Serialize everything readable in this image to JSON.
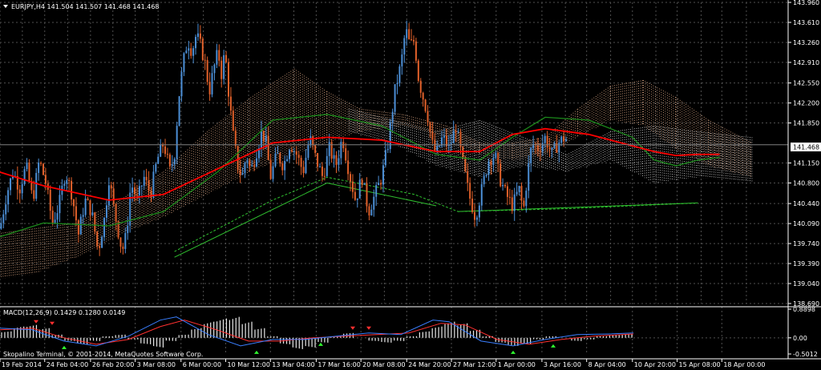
{
  "chart_data": [
    {
      "type": "candlestick",
      "symbol_header": "EURJPY,H4  141.504 141.507 141.468 141.468",
      "current_price": "141.468",
      "current_price_value": 141.468,
      "ylim": [
        138.69,
        143.96
      ],
      "y_ticks": [
        "143.960",
        "143.610",
        "143.260",
        "142.910",
        "142.550",
        "142.200",
        "141.850",
        "141.150",
        "140.800",
        "140.440",
        "140.090",
        "139.740",
        "139.390",
        "139.040",
        "138.690"
      ],
      "y_tick_values": [
        143.96,
        143.61,
        143.26,
        142.91,
        142.55,
        142.2,
        141.85,
        141.15,
        140.8,
        140.44,
        140.09,
        139.74,
        139.39,
        139.04,
        138.69
      ],
      "x_ticks": [
        "19 Feb 2014",
        "24 Feb 04:00",
        "26 Feb 20:00",
        "3 Mar 08:00",
        "6 Mar 00:00",
        "10 Mar 12:00",
        "13 Mar 04:00",
        "17 Mar 16:00",
        "20 Mar 08:00",
        "24 Mar 20:00",
        "27 Mar 12:00",
        "1 Apr 00:00",
        "3 Apr 16:00",
        "8 Apr 04:00",
        "10 Apr 20:00",
        "15 Apr 08:00",
        "18 Apr 00:00"
      ],
      "x_tick_pos": [
        0,
        41,
        83,
        124,
        166,
        207,
        248,
        290,
        331,
        373,
        414,
        455,
        497,
        538,
        580,
        621,
        662
      ],
      "close_path": [
        [
          0,
          140.0
        ],
        [
          6,
          140.6
        ],
        [
          12,
          141.0
        ],
        [
          18,
          140.7
        ],
        [
          24,
          141.1
        ],
        [
          30,
          140.5
        ],
        [
          36,
          141.2
        ],
        [
          42,
          140.8
        ],
        [
          48,
          140.1
        ],
        [
          54,
          140.4
        ],
        [
          60,
          141.0
        ],
        [
          66,
          140.6
        ],
        [
          72,
          139.9
        ],
        [
          78,
          140.5
        ],
        [
          84,
          140.3
        ],
        [
          90,
          139.6
        ],
        [
          96,
          140.2
        ],
        [
          100,
          140.9
        ],
        [
          104,
          140.4
        ],
        [
          108,
          140.0
        ],
        [
          112,
          139.6
        ],
        [
          116,
          139.9
        ],
        [
          120,
          140.8
        ],
        [
          126,
          140.5
        ],
        [
          132,
          140.9
        ],
        [
          138,
          140.6
        ],
        [
          144,
          141.2
        ],
        [
          150,
          141.5
        ],
        [
          156,
          141.0
        ],
        [
          160,
          141.3
        ],
        [
          164,
          142.3
        ],
        [
          168,
          142.9
        ],
        [
          172,
          143.3
        ],
        [
          176,
          143.1
        ],
        [
          180,
          143.4
        ],
        [
          184,
          143.2
        ],
        [
          188,
          142.9
        ],
        [
          192,
          142.4
        ],
        [
          196,
          142.8
        ],
        [
          200,
          143.1
        ],
        [
          204,
          142.6
        ],
        [
          206,
          143.2
        ],
        [
          210,
          142.3
        ],
        [
          214,
          141.6
        ],
        [
          218,
          141.1
        ],
        [
          222,
          140.9
        ],
        [
          226,
          141.3
        ],
        [
          230,
          141.0
        ],
        [
          236,
          141.4
        ],
        [
          240,
          141.7
        ],
        [
          244,
          141.5
        ],
        [
          248,
          140.9
        ],
        [
          254,
          141.3
        ],
        [
          260,
          141.1
        ],
        [
          266,
          141.5
        ],
        [
          272,
          141.3
        ],
        [
          278,
          141.0
        ],
        [
          284,
          141.6
        ],
        [
          290,
          141.2
        ],
        [
          296,
          140.9
        ],
        [
          302,
          141.4
        ],
        [
          308,
          141.1
        ],
        [
          314,
          141.6
        ],
        [
          320,
          141.0
        ],
        [
          326,
          140.5
        ],
        [
          332,
          140.9
        ],
        [
          338,
          140.3
        ],
        [
          344,
          140.6
        ],
        [
          350,
          140.9
        ],
        [
          356,
          141.5
        ],
        [
          362,
          142.4
        ],
        [
          368,
          142.9
        ],
        [
          372,
          143.5
        ],
        [
          376,
          143.2
        ],
        [
          380,
          143.3
        ],
        [
          384,
          142.6
        ],
        [
          388,
          142.3
        ],
        [
          392,
          142.0
        ],
        [
          396,
          141.5
        ],
        [
          400,
          141.3
        ],
        [
          406,
          141.6
        ],
        [
          412,
          141.4
        ],
        [
          418,
          141.8
        ],
        [
          424,
          141.2
        ],
        [
          430,
          140.6
        ],
        [
          436,
          140.2
        ],
        [
          442,
          140.7
        ],
        [
          448,
          141.2
        ],
        [
          454,
          141.3
        ],
        [
          458,
          140.9
        ],
        [
          464,
          140.6
        ],
        [
          470,
          140.4
        ],
        [
          476,
          140.7
        ],
        [
          480,
          140.3
        ],
        [
          484,
          141.0
        ],
        [
          488,
          141.5
        ],
        [
          494,
          141.4
        ],
        [
          500,
          141.6
        ],
        [
          506,
          141.3
        ],
        [
          512,
          141.5
        ],
        [
          518,
          141.6
        ],
        [
          521,
          141.5
        ]
      ],
      "sma_red": [
        [
          -10,
          141.05
        ],
        [
          40,
          140.75
        ],
        [
          100,
          140.5
        ],
        [
          150,
          140.6
        ],
        [
          200,
          141.05
        ],
        [
          250,
          141.5
        ],
        [
          300,
          141.6
        ],
        [
          350,
          141.55
        ],
        [
          400,
          141.35
        ],
        [
          440,
          141.35
        ],
        [
          470,
          141.65
        ],
        [
          500,
          141.75
        ],
        [
          540,
          141.65
        ],
        [
          580,
          141.45
        ],
        [
          600,
          141.35
        ],
        [
          620,
          141.28
        ],
        [
          640,
          141.3
        ],
        [
          660,
          141.3
        ]
      ],
      "sma_green": [
        [
          -10,
          139.8
        ],
        [
          40,
          140.1
        ],
        [
          100,
          140.05
        ],
        [
          150,
          140.3
        ],
        [
          200,
          141.0
        ],
        [
          250,
          141.9
        ],
        [
          300,
          142.0
        ],
        [
          350,
          141.8
        ],
        [
          400,
          141.3
        ],
        [
          440,
          141.2
        ],
        [
          470,
          141.6
        ],
        [
          500,
          141.95
        ],
        [
          540,
          141.9
        ],
        [
          580,
          141.6
        ],
        [
          600,
          141.2
        ],
        [
          620,
          141.1
        ],
        [
          640,
          141.2
        ],
        [
          660,
          141.25
        ]
      ],
      "cloud_orange": [
        [
          -10,
          139.9,
          139.1
        ],
        [
          30,
          140.0,
          139.2
        ],
        [
          70,
          140.1,
          139.5
        ],
        [
          110,
          140.5,
          139.9
        ],
        [
          150,
          141.0,
          140.2
        ],
        [
          190,
          141.7,
          140.6
        ],
        [
          230,
          142.3,
          141.0
        ],
        [
          270,
          142.8,
          141.3
        ],
        [
          300,
          142.4,
          141.5
        ],
        [
          330,
          142.1,
          141.7
        ],
        [
          370,
          142.0,
          141.8
        ],
        [
          410,
          141.8,
          141.6
        ],
        [
          440,
          141.5,
          141.3
        ],
        [
          470,
          141.5,
          141.2
        ],
        [
          500,
          141.6,
          141.3
        ],
        [
          530,
          142.1,
          141.6
        ],
        [
          560,
          142.5,
          141.9
        ],
        [
          590,
          142.6,
          141.8
        ],
        [
          620,
          142.3,
          141.4
        ],
        [
          650,
          141.9,
          141.1
        ],
        [
          690,
          141.5,
          140.9
        ]
      ],
      "cloud_white": [
        [
          320,
          142.1,
          141.7
        ],
        [
          360,
          141.9,
          141.5
        ],
        [
          400,
          141.7,
          141.1
        ],
        [
          440,
          141.9,
          140.9
        ],
        [
          480,
          141.6,
          141.1
        ],
        [
          520,
          141.3,
          141.0
        ],
        [
          560,
          141.7,
          141.2
        ],
        [
          600,
          141.8,
          140.8
        ],
        [
          640,
          141.7,
          140.9
        ],
        [
          690,
          141.6,
          140.8
        ]
      ],
      "trend_lines": [
        [
          [
            160,
            139.5
          ],
          [
            300,
            140.8
          ]
        ],
        [
          [
            300,
            140.8
          ],
          [
            400,
            140.4
          ]
        ],
        [
          [
            420,
            140.3
          ],
          [
            640,
            140.45
          ]
        ]
      ],
      "ichimoku_dash_green": [
        [
          160,
          139.6
        ],
        [
          250,
          140.5
        ],
        [
          300,
          140.9
        ],
        [
          380,
          140.6
        ],
        [
          420,
          140.3
        ],
        [
          520,
          140.35
        ],
        [
          640,
          140.45
        ]
      ]
    },
    {
      "type": "histogram",
      "header": "MACD(12,26,9) 0.1429 0.1280 0.0149",
      "ylim": [
        -0.5012,
        0.8898
      ],
      "y_ticks": [
        "0.8898",
        "0.00",
        "-0.5012"
      ],
      "y_tick_values": [
        0.8898,
        0.0,
        -0.5012
      ],
      "histogram_values": [
        0.2,
        0.35,
        0.4,
        0.3,
        0.1,
        -0.1,
        -0.2,
        -0.1,
        0.05,
        0.1,
        -0.05,
        -0.2,
        -0.3,
        -0.1,
        0.1,
        0.3,
        0.5,
        0.6,
        0.65,
        0.5,
        0.3,
        0.05,
        -0.2,
        -0.35,
        -0.3,
        -0.15,
        0.05,
        0.15,
        0.0,
        -0.1,
        -0.15,
        -0.1,
        0.05,
        0.2,
        0.35,
        0.5,
        0.45,
        0.25,
        0.05,
        -0.15,
        -0.25,
        -0.2,
        -0.05,
        0.05,
        0.0,
        -0.1,
        -0.05,
        0.05,
        0.1,
        0.12
      ],
      "macd_line": [
        [
          0,
          0.3
        ],
        [
          40,
          0.25
        ],
        [
          80,
          -0.1
        ],
        [
          120,
          -0.25
        ],
        [
          160,
          0.05
        ],
        [
          200,
          0.55
        ],
        [
          220,
          0.65
        ],
        [
          260,
          0.1
        ],
        [
          300,
          -0.25
        ],
        [
          340,
          -0.05
        ],
        [
          380,
          -0.05
        ],
        [
          420,
          0.05
        ],
        [
          460,
          0.15
        ],
        [
          500,
          0.1
        ],
        [
          540,
          0.55
        ],
        [
          560,
          0.5
        ],
        [
          600,
          -0.1
        ],
        [
          640,
          -0.25
        ],
        [
          680,
          -0.05
        ],
        [
          720,
          0.1
        ],
        [
          760,
          0.12
        ],
        [
          790,
          0.15
        ]
      ],
      "signal_line": [
        [
          0,
          0.25
        ],
        [
          40,
          0.3
        ],
        [
          80,
          0.0
        ],
        [
          120,
          -0.2
        ],
        [
          160,
          -0.05
        ],
        [
          200,
          0.35
        ],
        [
          230,
          0.55
        ],
        [
          270,
          0.25
        ],
        [
          310,
          -0.1
        ],
        [
          350,
          -0.1
        ],
        [
          390,
          0.0
        ],
        [
          430,
          0.05
        ],
        [
          470,
          0.1
        ],
        [
          510,
          0.15
        ],
        [
          550,
          0.45
        ],
        [
          580,
          0.4
        ],
        [
          620,
          -0.05
        ],
        [
          660,
          -0.2
        ],
        [
          700,
          -0.05
        ],
        [
          740,
          0.05
        ],
        [
          790,
          0.12
        ]
      ],
      "signal_arrows_up": [
        [
          80,
          -0.1
        ],
        [
          320,
          -0.25
        ],
        [
          400,
          0.0
        ],
        [
          640,
          -0.25
        ],
        [
          690,
          -0.05
        ]
      ],
      "signal_arrows_down": [
        [
          45,
          0.3
        ],
        [
          65,
          0.25
        ],
        [
          440,
          0.1
        ],
        [
          460,
          0.1
        ]
      ]
    }
  ],
  "copyright": "Skopalino Terminal, © 2001-2014, MetaQuotes Software Corp.",
  "colors": {
    "bull": "#4c8fd6",
    "bear": "#e0602a",
    "sma_red": "#ff0000",
    "sma_green": "#1b8a1b",
    "grid": "#4f4f4f",
    "cloud_orange": "#e8b08a",
    "cloud_white": "#dddddd",
    "trend": "#2fbf2f"
  }
}
